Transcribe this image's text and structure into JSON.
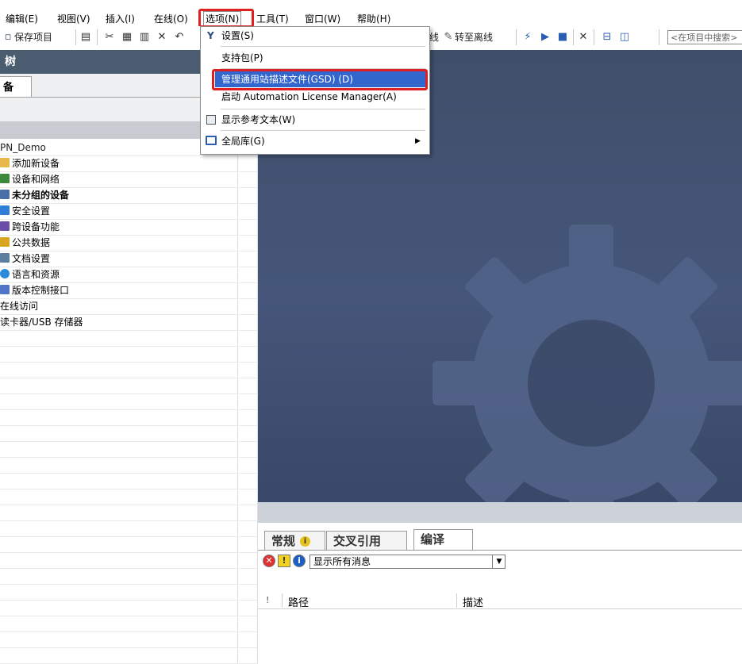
{
  "menubar": {
    "items": [
      "编辑(E)",
      "视图(V)",
      "插入(I)",
      "在线(O)",
      "选项(N)",
      "工具(T)",
      "窗口(W)",
      "帮助(H)"
    ]
  },
  "toolbar": {
    "save_label": "保存项目",
    "go_online_partial": "线",
    "go_offline_label": "转至离线",
    "search_placeholder": "<在项目中搜索>"
  },
  "dropdown": {
    "items": [
      "设置(S)",
      "支持包(P)",
      "管理通用站描述文件(GSD) (D)",
      "启动 Automation License Manager(A)",
      "显示参考文本(W)",
      "全局库(G)"
    ]
  },
  "project_tree": {
    "title": "树",
    "tab": "备",
    "root": "PN_Demo",
    "items": [
      "添加新设备",
      "设备和网络",
      "未分组的设备",
      "安全设置",
      "跨设备功能",
      "公共数据",
      "文档设置",
      "语言和资源",
      "版本控制接口"
    ],
    "sections": [
      "在线访问",
      "读卡器/USB 存储器"
    ]
  },
  "inspector": {
    "tabs": [
      "常规",
      "交叉引用",
      "编译"
    ],
    "filter": "显示所有消息",
    "columns": [
      "!",
      "路径",
      "描述"
    ]
  },
  "colors": {
    "highlight_red": "#e02020",
    "selection_blue": "#3366cc",
    "workspace_bg": "#45567a"
  }
}
